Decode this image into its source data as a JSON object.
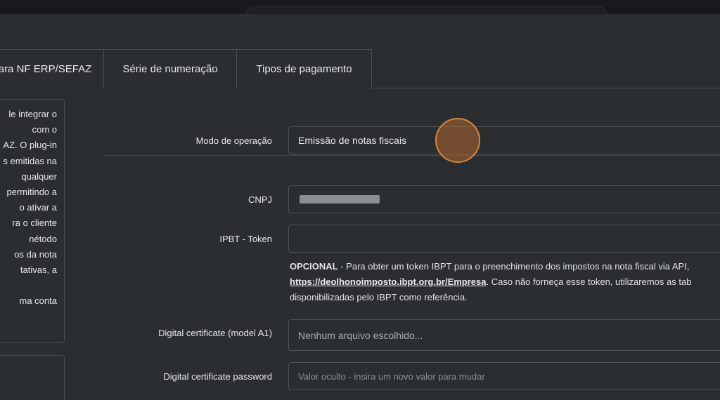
{
  "tabs": [
    {
      "label": "ara NF ERP/SEFAZ"
    },
    {
      "label": "Série de numeração"
    },
    {
      "label": "Tipos de pagamento"
    }
  ],
  "description": {
    "lines": [
      "le integrar o",
      "com o",
      "AZ. O plug-in",
      "s emitidas na",
      "qualquer",
      "permitindo a",
      "o ativar a",
      "ra o cliente",
      "nétodo",
      "os da nota",
      "tativas, a",
      "",
      "ma conta"
    ]
  },
  "form": {
    "operation_mode": {
      "label": "Modo de operação",
      "value": "Emissão de notas fiscais"
    },
    "cnpj": {
      "label": "CNPJ"
    },
    "ibpt_token": {
      "label": "IPBT - Token",
      "value": ""
    },
    "help": {
      "prefix": "OPCIONAL",
      "line1": " - Para obter um token IBPT para o preenchimento dos impostos na nota fiscal via API,",
      "link": "https://deolhonoimposto.ibpt.org.br/Empresa",
      "line2": ". Caso não forneça esse token, utilizaremos as tab",
      "line3": "disponibilizadas pelo IBPT como referência."
    },
    "certificate": {
      "label": "Digital certificate (model A1)",
      "value": "Nenhum arquivo escolhido..."
    },
    "certificate_password": {
      "label": "Digital certificate password",
      "placeholder": "Valor oculto - insira um novo valor para mudar"
    }
  },
  "colors": {
    "cursor": "#d5853f",
    "background": "#2b2e31",
    "border": "#4a4d51"
  }
}
